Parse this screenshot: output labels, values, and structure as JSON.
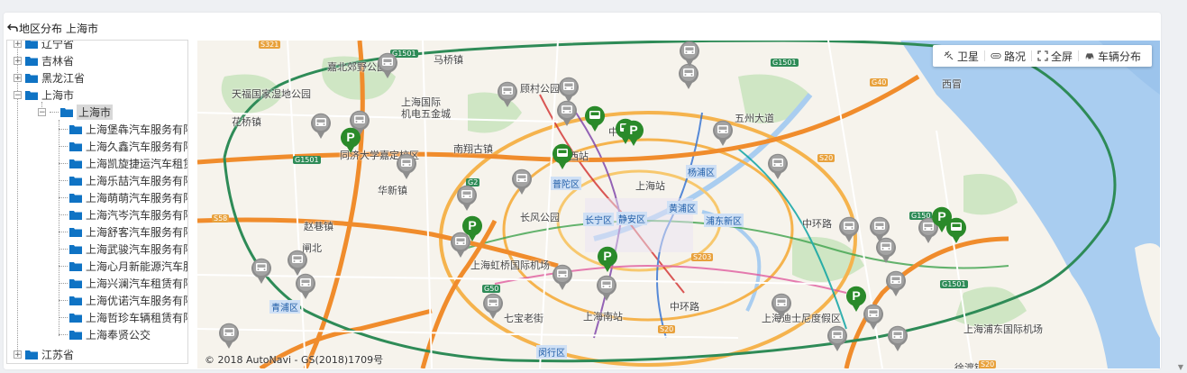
{
  "header": {
    "back_label": "地区分布",
    "current_area": "上海市"
  },
  "tree": {
    "items": [
      {
        "label": "辽宁省",
        "level": 0,
        "state": "+"
      },
      {
        "label": "吉林省",
        "level": 0,
        "state": "+"
      },
      {
        "label": "黑龙江省",
        "level": 0,
        "state": "+"
      },
      {
        "label": "上海市",
        "level": 0,
        "state": "-"
      },
      {
        "label": "上海市",
        "level": 1,
        "state": "-",
        "selected": true
      },
      {
        "label": "上海堡犇汽车服务有限",
        "level": 2
      },
      {
        "label": "上海久鑫汽车服务有限",
        "level": 2
      },
      {
        "label": "上海凯旋捷运汽车租赁",
        "level": 2
      },
      {
        "label": "上海乐喆汽车服务有限",
        "level": 2
      },
      {
        "label": "上海萌萌汽车服务有限",
        "level": 2
      },
      {
        "label": "上海汽岑汽车服务有限",
        "level": 2
      },
      {
        "label": "上海舒客汽车服务有限",
        "level": 2
      },
      {
        "label": "上海武骏汽车服务有限",
        "level": 2
      },
      {
        "label": "上海心月新能源汽车服",
        "level": 2
      },
      {
        "label": "上海兴澜汽车租赁有限",
        "level": 2
      },
      {
        "label": "上海优诺汽车服务有限",
        "level": 2
      },
      {
        "label": "上海哲珍车辆租赁有限",
        "level": 2
      },
      {
        "label": "上海奉贤公交",
        "level": 2
      },
      {
        "label": "江苏省",
        "level": 0,
        "state": "+"
      }
    ]
  },
  "map_tools": {
    "satellite": "卫星",
    "traffic": "路况",
    "fullscreen": "全屏",
    "vehicles": "车辆分布"
  },
  "map_labels": {
    "l1": "嘉北郊野公园",
    "l2": "天福国家湿地公园",
    "l3": "花桥镇",
    "l4": "上海国际",
    "l5": "机电五金城",
    "l6": "顾村公园",
    "l7": "马桥镇",
    "l8": "南翔古镇",
    "l9": "同济大学嘉定校区",
    "l10": "华新镇",
    "l11": "五州大道",
    "l12": "普陀区",
    "l13": "上海站",
    "l14": "长风公园",
    "l15": "长宁区",
    "l16": "静安区",
    "l17": "杨浦区",
    "l18": "黄浦区",
    "l19": "浦东新区",
    "l20": "上海虹桥国际机场",
    "l21": "七宝老街",
    "l22": "上海南站",
    "l23": "中环路",
    "l24": "上海迪士尼度假区",
    "l25": "上海浦东国际机场",
    "l26": "青浦区",
    "l27": "闵行区",
    "l28": "赵巷镇",
    "l29": "西站",
    "l30": "中山",
    "l31": "西冒",
    "l32": "徐渡镇",
    "l33": "闸北",
    "l34": "中环路"
  },
  "highways": {
    "h1": "G1501",
    "h2": "G1501",
    "h3": "G2",
    "h4": "G50",
    "h5": "S20",
    "h6": "S20",
    "h7": "G40",
    "h8": "S58",
    "h9": "G1501",
    "h10": "S321",
    "h11": "G150",
    "h12": "S203",
    "h13": "G1501",
    "h14": "S20"
  },
  "copyright": "© 2018 AutoNavi - GS(2018)1709号",
  "colors": {
    "parking_pin": "#2a8a2a",
    "bus_pin": "#8d8d8d",
    "water": "#a9cdf0"
  },
  "pins": {
    "parking_icon": "parking-pin-icon",
    "bus_icon": "bus-pin-icon"
  }
}
